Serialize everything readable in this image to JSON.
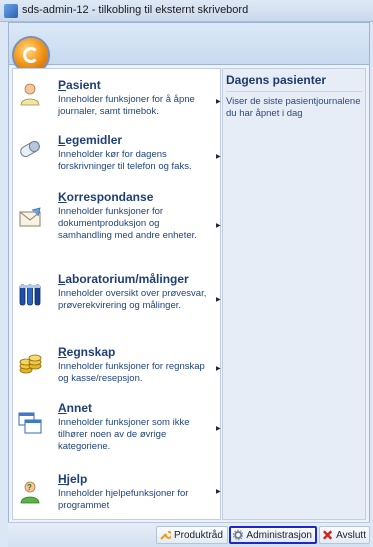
{
  "window": {
    "title": "sds-admin-12 - tilkobling til eksternt skrivebord"
  },
  "menu": {
    "items": [
      {
        "accel": "P",
        "rest": "asient",
        "desc": "Inneholder funksjoner for å åpne journaler, samt timebok.",
        "icon": "patient-icon"
      },
      {
        "accel": "L",
        "rest": "egemidler",
        "desc": "Inneholder kør for dagens forskrivninger til telefon og faks.",
        "icon": "pill-icon"
      },
      {
        "accel": "K",
        "rest": "orrespondanse",
        "desc": "Inneholder funksjoner for dokumentproduksjon og samhandling med andre enheter.",
        "icon": "envelope-icon"
      },
      {
        "accel": "L",
        "rest": "aboratorium/målinger",
        "desc": "Inneholder oversikt over prøvesvar, prøverekvirering og målinger.",
        "icon": "lab-tubes-icon"
      },
      {
        "accel": "R",
        "rest": "egnskap",
        "desc": "Inneholder funksjoner for regnskap og kasse/resepsjon.",
        "icon": "coins-icon"
      },
      {
        "accel": "A",
        "rest": "nnet",
        "desc": "Inneholder funksjoner som ikke tilhører noen av de øvrige kategoriene.",
        "icon": "windows-icon"
      },
      {
        "accel": "H",
        "rest": "jelp",
        "desc": "Inneholder hjelpefunksjoner for programmet",
        "icon": "help-person-icon"
      }
    ]
  },
  "recent": {
    "title": "Dagens pasienter",
    "desc": "Viser de siste pasientjournalene du har åpnet i dag"
  },
  "footer": {
    "produkt_label": "Produktråd",
    "admin_label": "Administrasjon",
    "exit_label": "Avslutt"
  },
  "colors": {
    "heading": "#1f3f76",
    "text": "#21457f",
    "highlight": "#1e27c8"
  }
}
